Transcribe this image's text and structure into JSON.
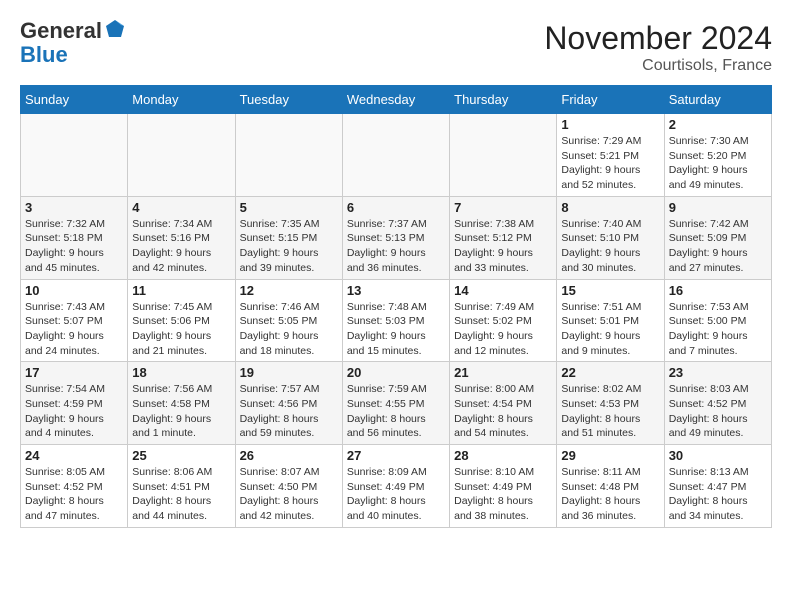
{
  "header": {
    "logo_general": "General",
    "logo_blue": "Blue",
    "month_title": "November 2024",
    "location": "Courtisols, France"
  },
  "calendar": {
    "days_of_week": [
      "Sunday",
      "Monday",
      "Tuesday",
      "Wednesday",
      "Thursday",
      "Friday",
      "Saturday"
    ],
    "weeks": [
      [
        {
          "day": "",
          "info": "",
          "empty": true
        },
        {
          "day": "",
          "info": "",
          "empty": true
        },
        {
          "day": "",
          "info": "",
          "empty": true
        },
        {
          "day": "",
          "info": "",
          "empty": true
        },
        {
          "day": "",
          "info": "",
          "empty": true
        },
        {
          "day": "1",
          "info": "Sunrise: 7:29 AM\nSunset: 5:21 PM\nDaylight: 9 hours\nand 52 minutes.",
          "empty": false
        },
        {
          "day": "2",
          "info": "Sunrise: 7:30 AM\nSunset: 5:20 PM\nDaylight: 9 hours\nand 49 minutes.",
          "empty": false
        }
      ],
      [
        {
          "day": "3",
          "info": "Sunrise: 7:32 AM\nSunset: 5:18 PM\nDaylight: 9 hours\nand 45 minutes.",
          "empty": false
        },
        {
          "day": "4",
          "info": "Sunrise: 7:34 AM\nSunset: 5:16 PM\nDaylight: 9 hours\nand 42 minutes.",
          "empty": false
        },
        {
          "day": "5",
          "info": "Sunrise: 7:35 AM\nSunset: 5:15 PM\nDaylight: 9 hours\nand 39 minutes.",
          "empty": false
        },
        {
          "day": "6",
          "info": "Sunrise: 7:37 AM\nSunset: 5:13 PM\nDaylight: 9 hours\nand 36 minutes.",
          "empty": false
        },
        {
          "day": "7",
          "info": "Sunrise: 7:38 AM\nSunset: 5:12 PM\nDaylight: 9 hours\nand 33 minutes.",
          "empty": false
        },
        {
          "day": "8",
          "info": "Sunrise: 7:40 AM\nSunset: 5:10 PM\nDaylight: 9 hours\nand 30 minutes.",
          "empty": false
        },
        {
          "day": "9",
          "info": "Sunrise: 7:42 AM\nSunset: 5:09 PM\nDaylight: 9 hours\nand 27 minutes.",
          "empty": false
        }
      ],
      [
        {
          "day": "10",
          "info": "Sunrise: 7:43 AM\nSunset: 5:07 PM\nDaylight: 9 hours\nand 24 minutes.",
          "empty": false
        },
        {
          "day": "11",
          "info": "Sunrise: 7:45 AM\nSunset: 5:06 PM\nDaylight: 9 hours\nand 21 minutes.",
          "empty": false
        },
        {
          "day": "12",
          "info": "Sunrise: 7:46 AM\nSunset: 5:05 PM\nDaylight: 9 hours\nand 18 minutes.",
          "empty": false
        },
        {
          "day": "13",
          "info": "Sunrise: 7:48 AM\nSunset: 5:03 PM\nDaylight: 9 hours\nand 15 minutes.",
          "empty": false
        },
        {
          "day": "14",
          "info": "Sunrise: 7:49 AM\nSunset: 5:02 PM\nDaylight: 9 hours\nand 12 minutes.",
          "empty": false
        },
        {
          "day": "15",
          "info": "Sunrise: 7:51 AM\nSunset: 5:01 PM\nDaylight: 9 hours\nand 9 minutes.",
          "empty": false
        },
        {
          "day": "16",
          "info": "Sunrise: 7:53 AM\nSunset: 5:00 PM\nDaylight: 9 hours\nand 7 minutes.",
          "empty": false
        }
      ],
      [
        {
          "day": "17",
          "info": "Sunrise: 7:54 AM\nSunset: 4:59 PM\nDaylight: 9 hours\nand 4 minutes.",
          "empty": false
        },
        {
          "day": "18",
          "info": "Sunrise: 7:56 AM\nSunset: 4:58 PM\nDaylight: 9 hours\nand 1 minute.",
          "empty": false
        },
        {
          "day": "19",
          "info": "Sunrise: 7:57 AM\nSunset: 4:56 PM\nDaylight: 8 hours\nand 59 minutes.",
          "empty": false
        },
        {
          "day": "20",
          "info": "Sunrise: 7:59 AM\nSunset: 4:55 PM\nDaylight: 8 hours\nand 56 minutes.",
          "empty": false
        },
        {
          "day": "21",
          "info": "Sunrise: 8:00 AM\nSunset: 4:54 PM\nDaylight: 8 hours\nand 54 minutes.",
          "empty": false
        },
        {
          "day": "22",
          "info": "Sunrise: 8:02 AM\nSunset: 4:53 PM\nDaylight: 8 hours\nand 51 minutes.",
          "empty": false
        },
        {
          "day": "23",
          "info": "Sunrise: 8:03 AM\nSunset: 4:52 PM\nDaylight: 8 hours\nand 49 minutes.",
          "empty": false
        }
      ],
      [
        {
          "day": "24",
          "info": "Sunrise: 8:05 AM\nSunset: 4:52 PM\nDaylight: 8 hours\nand 47 minutes.",
          "empty": false
        },
        {
          "day": "25",
          "info": "Sunrise: 8:06 AM\nSunset: 4:51 PM\nDaylight: 8 hours\nand 44 minutes.",
          "empty": false
        },
        {
          "day": "26",
          "info": "Sunrise: 8:07 AM\nSunset: 4:50 PM\nDaylight: 8 hours\nand 42 minutes.",
          "empty": false
        },
        {
          "day": "27",
          "info": "Sunrise: 8:09 AM\nSunset: 4:49 PM\nDaylight: 8 hours\nand 40 minutes.",
          "empty": false
        },
        {
          "day": "28",
          "info": "Sunrise: 8:10 AM\nSunset: 4:49 PM\nDaylight: 8 hours\nand 38 minutes.",
          "empty": false
        },
        {
          "day": "29",
          "info": "Sunrise: 8:11 AM\nSunset: 4:48 PM\nDaylight: 8 hours\nand 36 minutes.",
          "empty": false
        },
        {
          "day": "30",
          "info": "Sunrise: 8:13 AM\nSunset: 4:47 PM\nDaylight: 8 hours\nand 34 minutes.",
          "empty": false
        }
      ]
    ]
  }
}
